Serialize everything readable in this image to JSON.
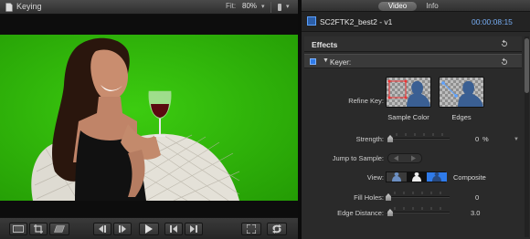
{
  "viewer": {
    "title": "Keying",
    "fit_label": "Fit:",
    "fit_value": "80%"
  },
  "inspector": {
    "tabs": [
      {
        "label": "Video",
        "selected": true
      },
      {
        "label": "Info",
        "selected": false
      }
    ],
    "clip_name": "SC2FTK2_best2 - v1",
    "timecode": "00:00:08:15",
    "effects_label": "Effects",
    "keyer": {
      "label": "Keyer:",
      "enabled": true,
      "refine_key_label": "Refine Key:",
      "sample_color_label": "Sample Color",
      "edges_label": "Edges",
      "strength_label": "Strength:",
      "strength_value": "0",
      "strength_unit": "%",
      "strength_level": 0,
      "jump_label": "Jump to Sample:",
      "view_label": "View:",
      "view_mode": "Composite",
      "fill_holes_label": "Fill Holes:",
      "fill_holes_value": "0",
      "fill_holes_level": 0,
      "edge_distance_label": "Edge Distance:",
      "edge_distance_value": "3.0",
      "edge_distance_level": 0.03
    }
  },
  "colors": {
    "green_screen": "#2db507",
    "accent_blue": "#2f7bea",
    "timecode_blue": "#77aef5"
  },
  "icons": {
    "viewer_title": "document-icon",
    "audio": "audio-meter-icon",
    "reset": "reset-arrow-icon",
    "toolbar": [
      "layout-icon",
      "crop-icon",
      "distort-icon",
      "previous-edit-icon",
      "play-around-icon",
      "play-icon",
      "previous-frame-icon",
      "next-frame-icon",
      "fullscreen-icon",
      "loop-icon"
    ]
  }
}
